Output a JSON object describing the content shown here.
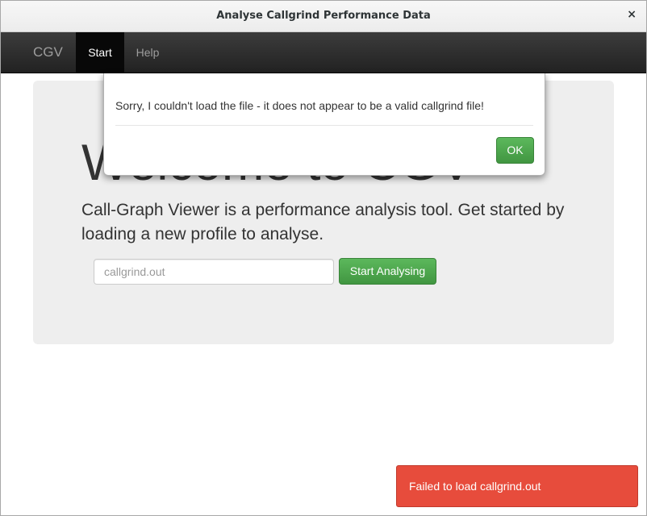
{
  "window": {
    "title": "Analyse Callgrind Performance Data",
    "close_glyph": "×",
    "close_icon": "close-icon"
  },
  "navbar": {
    "brand": "CGV",
    "items": [
      {
        "label": "Start",
        "active": true
      },
      {
        "label": "Help",
        "active": false
      }
    ]
  },
  "jumbotron": {
    "heading": "Welcome to CGV",
    "text": "Call-Graph Viewer is a performance analysis tool. Get started by loading a new profile to analyse.",
    "file_input": {
      "value": "",
      "placeholder": "callgrind.out"
    },
    "start_button": "Start Analysing"
  },
  "modal": {
    "message": "Sorry, I couldn't load the file - it does not appear to be a valid callgrind file!",
    "ok_button": "OK"
  },
  "toast": {
    "message": "Failed to load callgrind.out"
  },
  "colors": {
    "navbar_bg": "#222222",
    "success": "#5cb85c",
    "error": "#e74c3c",
    "jumbotron_bg": "#eeeeee"
  }
}
